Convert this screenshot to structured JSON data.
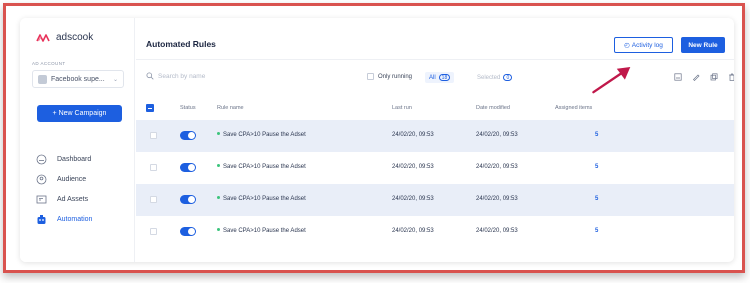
{
  "brand": {
    "name": "adscook",
    "color": "#e8325a"
  },
  "sidebar": {
    "account_label": "AD ACCOUNT",
    "account_value": "Facebook supe...",
    "new_campaign_label": "+ New Campaign",
    "items": [
      {
        "label": "Dashboard",
        "icon": "dashboard-icon"
      },
      {
        "label": "Audience",
        "icon": "audience-icon"
      },
      {
        "label": "Ad Assets",
        "icon": "ad-assets-icon"
      },
      {
        "label": "Automation",
        "icon": "automation-icon",
        "active": true
      }
    ]
  },
  "header": {
    "title": "Automated Rules",
    "activity_log_label": "Activity log",
    "new_rule_label": "New Rule"
  },
  "toolbar": {
    "search_placeholder": "Search by name",
    "only_running_label": "Only running",
    "all_label": "All",
    "all_count": "18",
    "selected_label": "Selected",
    "selected_count": "0"
  },
  "table": {
    "columns": [
      "Status",
      "Rule name",
      "Last run",
      "Date modified",
      "Assigned items"
    ],
    "rows": [
      {
        "name": "Save CPA>10 Pause the Adset",
        "last_run": "24/02/20, 09:53",
        "modified": "24/02/20, 09:53",
        "assigned": "5",
        "status_on": true
      },
      {
        "name": "Save CPA>10 Pause the Adset",
        "last_run": "24/02/20, 09:53",
        "modified": "24/02/20, 09:53",
        "assigned": "5",
        "status_on": true
      },
      {
        "name": "Save CPA>10 Pause the Adset",
        "last_run": "24/02/20, 09:53",
        "modified": "24/02/20, 09:53",
        "assigned": "5",
        "status_on": true
      },
      {
        "name": "Save CPA>10 Pause the Adset",
        "last_run": "24/02/20, 09:53",
        "modified": "24/02/20, 09:53",
        "assigned": "5",
        "status_on": true
      }
    ]
  },
  "colors": {
    "accent": "#1d5fe0",
    "highlight_border": "#d9534f",
    "arrow": "#c0184a",
    "row_shade": "#e9eef8",
    "running_dot": "#3cc47c"
  }
}
